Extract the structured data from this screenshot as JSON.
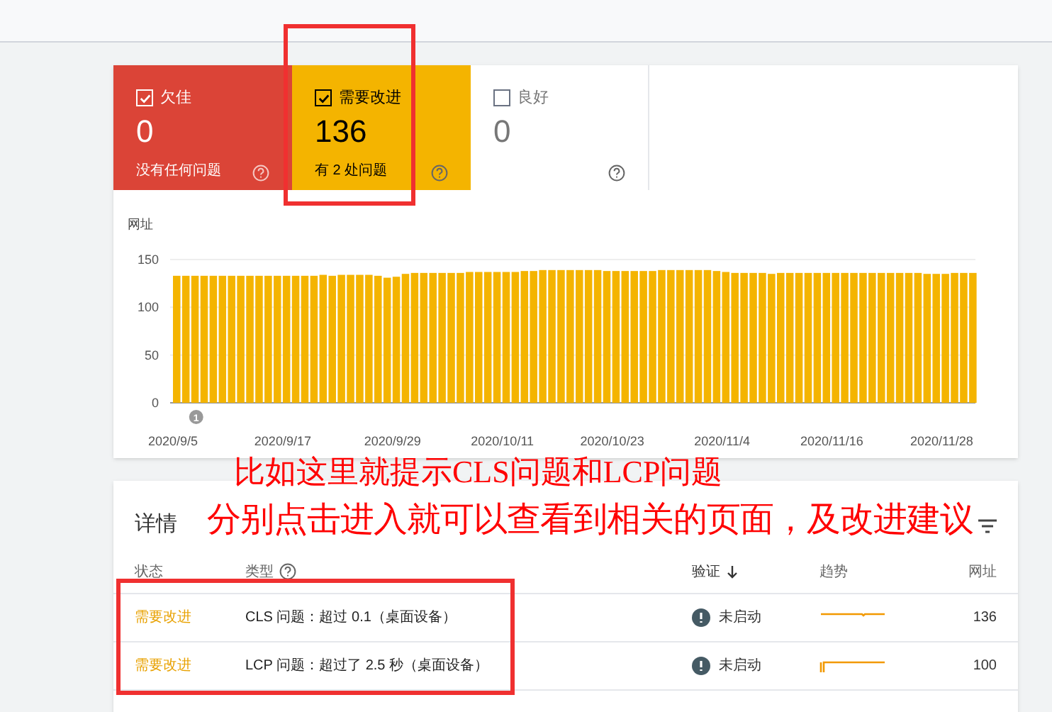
{
  "summary_tiles": [
    {
      "kind": "poor",
      "label": "欠佳",
      "checked": true,
      "count": "0",
      "subtitle": "没有任何问题"
    },
    {
      "kind": "needs",
      "label": "需要改进",
      "checked": true,
      "count": "136",
      "subtitle": "有 2 处问题"
    },
    {
      "kind": "good",
      "label": "良好",
      "checked": false,
      "count": "0"
    }
  ],
  "chart_data": {
    "type": "bar",
    "ylabel": "网址",
    "ylim": [
      0,
      150
    ],
    "yticks": [
      0,
      50,
      100,
      150
    ],
    "series": [
      {
        "color": "#f4b400",
        "values": [
          133,
          133,
          133,
          133,
          133,
          133,
          133,
          133,
          133,
          133,
          133,
          133,
          133,
          133,
          133,
          133,
          134,
          133,
          134,
          134,
          134,
          134,
          133,
          131,
          132,
          135,
          136,
          136,
          136,
          136,
          136,
          136,
          137,
          137,
          137,
          137,
          137,
          137,
          138,
          138,
          139,
          139,
          139,
          139,
          139,
          139,
          139,
          138,
          138,
          138,
          138,
          138,
          138,
          139,
          139,
          139,
          139,
          139,
          139,
          138,
          137,
          136,
          136,
          136,
          136,
          135,
          136,
          136,
          136,
          136,
          136,
          136,
          136,
          136,
          136,
          136,
          136,
          136,
          136,
          136,
          136,
          136,
          135,
          135,
          135,
          136,
          136,
          136
        ]
      }
    ]
  },
  "chart_x_labels": [
    "2020/9/5",
    "2020/9/17",
    "2020/9/29",
    "2020/10/11",
    "2020/10/23",
    "2020/11/4",
    "2020/11/16",
    "2020/11/28"
  ],
  "chart_event_markers": [
    {
      "label": "1"
    }
  ],
  "details": {
    "title": "详情",
    "columns": [
      {
        "kind": "text",
        "label": "状态"
      },
      {
        "kind": "help",
        "label": "类型"
      },
      {
        "kind": "sort",
        "label": "验证"
      },
      {
        "kind": "text",
        "label": "趋势"
      },
      {
        "kind": "text",
        "label": "网址"
      }
    ],
    "rows": [
      {
        "status": "需要改进",
        "type": "CLS 问题：超过 0.1（桌面设备）",
        "validation": "未启动",
        "urls": "136"
      },
      {
        "status": "需要改进",
        "type": "LCP 问题：超过了 2.5 秒（桌面设备）",
        "validation": "未启动",
        "urls": "100"
      }
    ]
  },
  "annotation_text": [
    "比如这里就提示CLS问题和LCP问题",
    "分别点击进入就可以查看到相关的页面，及改进建议"
  ]
}
